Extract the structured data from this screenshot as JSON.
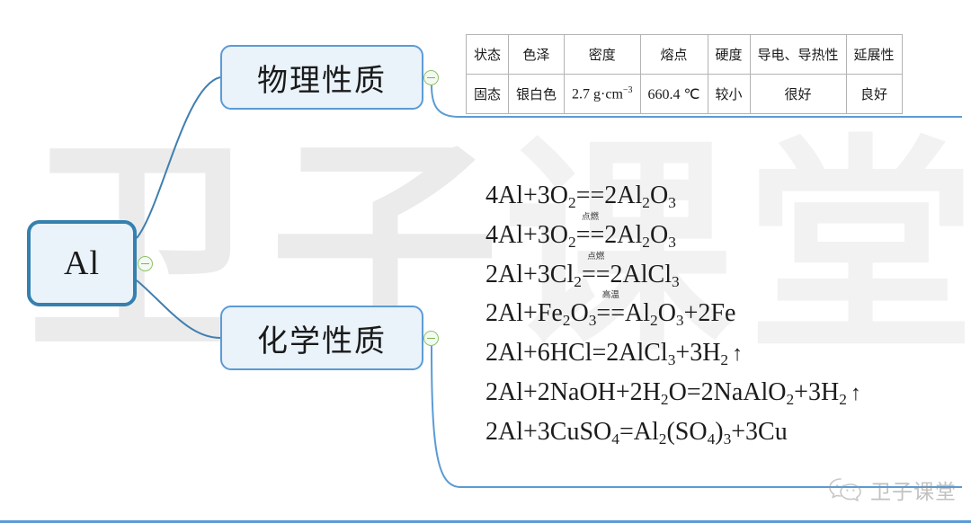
{
  "mindmap": {
    "root": {
      "label": "Al"
    },
    "branches": [
      {
        "id": "physical",
        "label": "物理性质"
      },
      {
        "id": "chemical",
        "label": "化学性质"
      }
    ],
    "collapse_icon": "minus-circle-icon",
    "accent_color": "#5b9bd5",
    "root_border_color": "#3580ae",
    "node_fill_color": "#eaf2fa",
    "collapse_color": "#8dc26b"
  },
  "properties_table": {
    "headers": [
      "状态",
      "色泽",
      "密度",
      "熔点",
      "硬度",
      "导电、导热性",
      "延展性"
    ],
    "values": {
      "state": "固态",
      "color": "银白色",
      "density_value": "2.7 g·cm",
      "density_exponent": "−3",
      "melting_point": "660.4 ℃",
      "hardness": "较小",
      "conductivity": "很好",
      "ductility": "良好"
    }
  },
  "equations": [
    {
      "parts": [
        {
          "t": "text",
          "v": "4Al+3O"
        },
        {
          "t": "sub",
          "v": "2"
        },
        {
          "t": "text",
          "v": "==2Al"
        },
        {
          "t": "sub",
          "v": "2"
        },
        {
          "t": "text",
          "v": "O"
        },
        {
          "t": "sub",
          "v": "3"
        }
      ]
    },
    {
      "parts": [
        {
          "t": "text",
          "v": "4Al+3O"
        },
        {
          "t": "sub",
          "v": "2"
        },
        {
          "t": "cond",
          "v": "==",
          "label": "点燃"
        },
        {
          "t": "text",
          "v": "2Al"
        },
        {
          "t": "sub",
          "v": "2"
        },
        {
          "t": "text",
          "v": "O"
        },
        {
          "t": "sub",
          "v": "3"
        }
      ]
    },
    {
      "parts": [
        {
          "t": "text",
          "v": "2Al+3Cl"
        },
        {
          "t": "sub",
          "v": "2"
        },
        {
          "t": "cond",
          "v": "==",
          "label": "点燃"
        },
        {
          "t": "text",
          "v": "2AlCl"
        },
        {
          "t": "sub",
          "v": "3"
        }
      ]
    },
    {
      "parts": [
        {
          "t": "text",
          "v": "2Al+Fe"
        },
        {
          "t": "sub",
          "v": "2"
        },
        {
          "t": "text",
          "v": "O"
        },
        {
          "t": "sub",
          "v": "3"
        },
        {
          "t": "cond",
          "v": "==",
          "label": "高温"
        },
        {
          "t": "text",
          "v": "Al"
        },
        {
          "t": "sub",
          "v": "2"
        },
        {
          "t": "text",
          "v": "O"
        },
        {
          "t": "sub",
          "v": "3"
        },
        {
          "t": "text",
          "v": "+2Fe"
        }
      ]
    },
    {
      "parts": [
        {
          "t": "text",
          "v": "2Al+6HCl=2AlCl"
        },
        {
          "t": "sub",
          "v": "3"
        },
        {
          "t": "text",
          "v": "+3H"
        },
        {
          "t": "sub",
          "v": "2"
        },
        {
          "t": "arrow",
          "v": "↑"
        }
      ]
    },
    {
      "parts": [
        {
          "t": "text",
          "v": "2Al+2NaOH+2H"
        },
        {
          "t": "sub",
          "v": "2"
        },
        {
          "t": "text",
          "v": "O=2NaAlO"
        },
        {
          "t": "sub",
          "v": "2"
        },
        {
          "t": "text",
          "v": "+3H"
        },
        {
          "t": "sub",
          "v": "2"
        },
        {
          "t": "arrow",
          "v": "↑"
        }
      ]
    },
    {
      "parts": [
        {
          "t": "text",
          "v": "2Al+3CuSO"
        },
        {
          "t": "sub",
          "v": "4"
        },
        {
          "t": "text",
          "v": "=Al"
        },
        {
          "t": "sub",
          "v": "2"
        },
        {
          "t": "text",
          "v": "(SO"
        },
        {
          "t": "sub",
          "v": "4"
        },
        {
          "t": "text",
          "v": ")"
        },
        {
          "t": "sub",
          "v": "3"
        },
        {
          "t": "text",
          "v": "+3Cu"
        }
      ]
    }
  ],
  "background_watermark": {
    "chars": [
      "卫",
      "子",
      "课",
      "堂"
    ],
    "color": "#ebebeb"
  },
  "brand_watermark": {
    "icon": "wechat-icon",
    "text": "卫子课堂",
    "color": "#8f8f8f"
  }
}
